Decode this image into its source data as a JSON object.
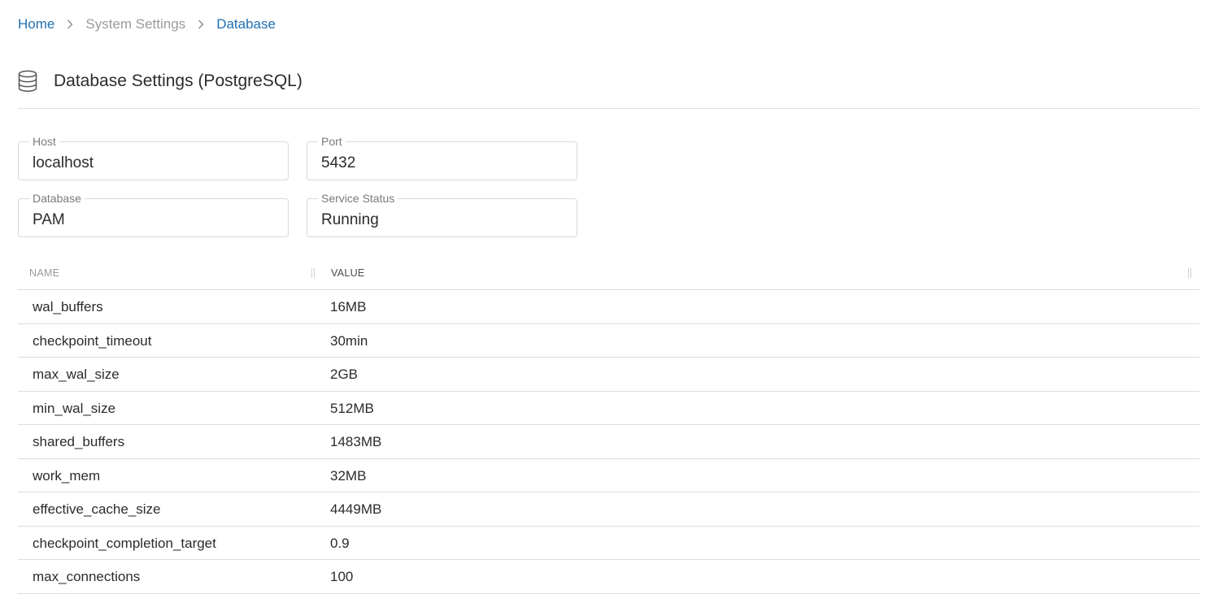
{
  "breadcrumb": {
    "home": "Home",
    "system_settings": "System Settings",
    "database": "Database"
  },
  "header": {
    "title": "Database Settings (PostgreSQL)",
    "icon": "database-icon"
  },
  "fields": {
    "host": {
      "label": "Host",
      "value": "localhost"
    },
    "port": {
      "label": "Port",
      "value": "5432"
    },
    "database": {
      "label": "Database",
      "value": "PAM"
    },
    "service_status": {
      "label": "Service Status",
      "value": "Running"
    }
  },
  "table": {
    "columns": {
      "name": "NAME",
      "value": "VALUE"
    },
    "rows": [
      {
        "name": "wal_buffers",
        "value": "16MB"
      },
      {
        "name": "checkpoint_timeout",
        "value": "30min"
      },
      {
        "name": "max_wal_size",
        "value": "2GB"
      },
      {
        "name": "min_wal_size",
        "value": "512MB"
      },
      {
        "name": "shared_buffers",
        "value": "1483MB"
      },
      {
        "name": "work_mem",
        "value": "32MB"
      },
      {
        "name": "effective_cache_size",
        "value": "4449MB"
      },
      {
        "name": "checkpoint_completion_target",
        "value": "0.9"
      },
      {
        "name": "max_connections",
        "value": "100"
      }
    ]
  },
  "colors": {
    "link": "#1f6fb2",
    "muted": "#9a9a9a",
    "border": "#d9d9d9"
  }
}
